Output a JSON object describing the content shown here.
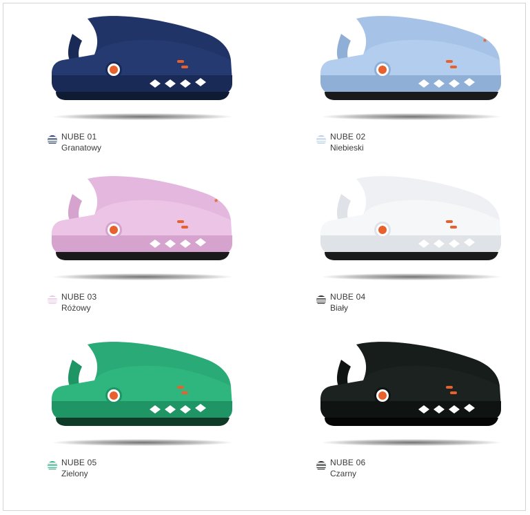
{
  "products": [
    {
      "code": "NUBE 01",
      "color_name": "Granatowy",
      "hex": "#263a72",
      "dark": "#1a2a56",
      "sole": "#0f1a33",
      "star": false
    },
    {
      "code": "NUBE 02",
      "color_name": "Niebieski",
      "hex": "#b3cdee",
      "dark": "#90afd6",
      "sole": "#1a1a1a",
      "star": true
    },
    {
      "code": "NUBE 03",
      "color_name": "Różowy",
      "hex": "#ecc4e6",
      "dark": "#d6a3cf",
      "sole": "#1a1a1a",
      "star": true
    },
    {
      "code": "NUBE 04",
      "color_name": "Biały",
      "hex": "#f6f7f9",
      "dark": "#dfe2e7",
      "sole": "#1a1a1a",
      "star": false
    },
    {
      "code": "NUBE 05",
      "color_name": "Zielony",
      "hex": "#2fb57e",
      "dark": "#1f9566",
      "sole": "#0f3a28",
      "star": false
    },
    {
      "code": "NUBE 06",
      "color_name": "Czarny",
      "hex": "#1b2220",
      "dark": "#0f1413",
      "sole": "#050505",
      "star": false
    }
  ],
  "star_mark": "*",
  "accent": "#e8602c"
}
